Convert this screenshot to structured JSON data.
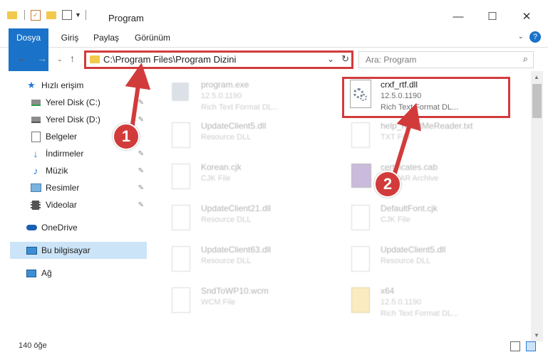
{
  "window": {
    "title": "Program",
    "minimize": "—",
    "maximize": "☐",
    "close": "✕"
  },
  "ribbon": {
    "tabs": [
      "Dosya",
      "Giriş",
      "Paylaş",
      "Görünüm"
    ]
  },
  "address": {
    "path": "C:\\Program Files\\Program Dizini",
    "search_placeholder": "Ara: Program"
  },
  "sidebar": {
    "items": [
      {
        "label": "Hızlı erişim",
        "icon": "star-icon"
      },
      {
        "label": "Yerel Disk (C:)",
        "icon": "drive-icon"
      },
      {
        "label": "Yerel Disk (D:)",
        "icon": "drive-icon"
      },
      {
        "label": "Belgeler",
        "icon": "documents-icon"
      },
      {
        "label": "İndirmeler",
        "icon": "download-icon"
      },
      {
        "label": "Müzik",
        "icon": "music-icon"
      },
      {
        "label": "Resimler",
        "icon": "pictures-icon"
      },
      {
        "label": "Videolar",
        "icon": "video-icon"
      },
      {
        "label": "OneDrive",
        "icon": "cloud-icon"
      },
      {
        "label": "Bu bilgisayar",
        "icon": "computer-icon"
      },
      {
        "label": "Ağ",
        "icon": "network-icon"
      }
    ]
  },
  "files": [
    {
      "name": "program.exe",
      "line2": "12.5.0.1190",
      "line3": "Rich Text Format DL..."
    },
    {
      "name": "crxf_rtf.dll",
      "line2": "12.5.0.1190",
      "line3": "Rich Text Format DL..."
    },
    {
      "name": "UpdateClient5.dll",
      "line2": "Resource DLL",
      "line3": ""
    },
    {
      "name": "help_ReadMeReader.txt",
      "line2": "TXT File",
      "line3": ""
    },
    {
      "name": "Korean.cjk",
      "line2": "CJK File",
      "line3": ""
    },
    {
      "name": "certificates.cab",
      "line2": "WinRAR Archive",
      "line3": ""
    },
    {
      "name": "UpdateClient21.dll",
      "line2": "Resource DLL",
      "line3": ""
    },
    {
      "name": "DefaultFont.cjk",
      "line2": "CJK File",
      "line3": ""
    },
    {
      "name": "UpdateClient63.dll",
      "line2": "Resource DLL",
      "line3": ""
    },
    {
      "name": "UpdateClient5.dll",
      "line2": "Resource DLL",
      "line3": ""
    },
    {
      "name": "SndToWP10.wcm",
      "line2": "WCM File",
      "line3": ""
    },
    {
      "name": "x64",
      "line2": "12.5.0.1190",
      "line3": "Rich Text Format DL..."
    }
  ],
  "status": {
    "count": "140 öğe"
  },
  "annotations": {
    "step1": "1",
    "step2": "2"
  },
  "colors": {
    "accent": "#1a73c9",
    "highlight": "#d23b3b",
    "selected_bg": "#cce4f7"
  }
}
